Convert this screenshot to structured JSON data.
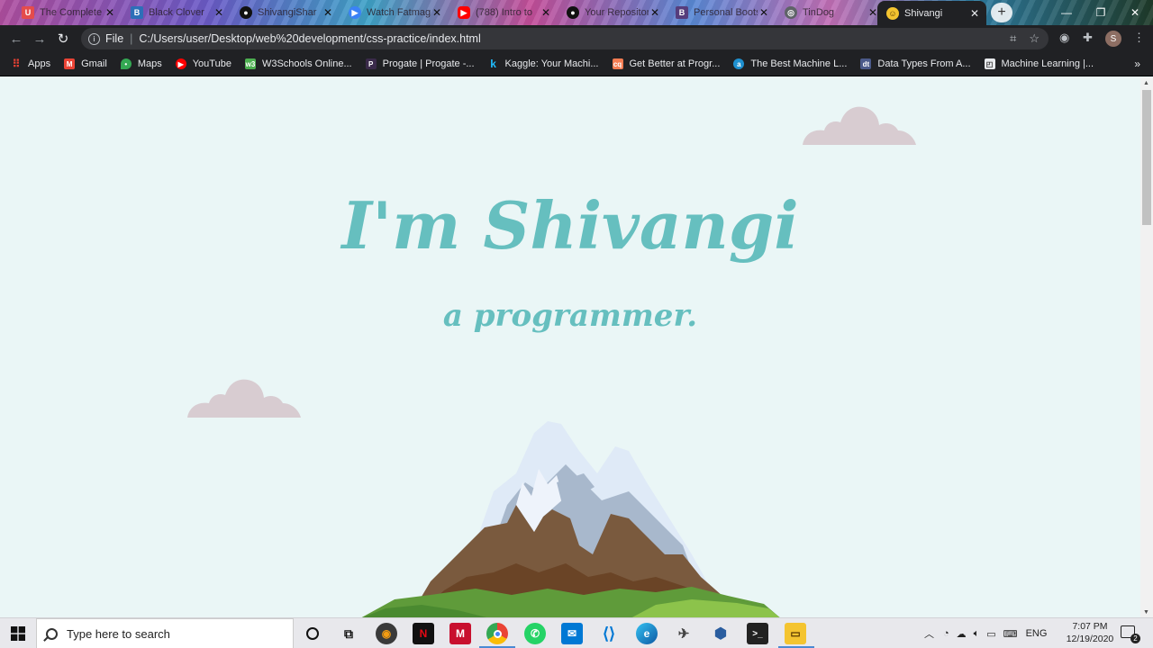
{
  "browser": {
    "tabs": [
      {
        "title": "The Complete",
        "favicon": "udemy-icon",
        "color": "#e44c4c"
      },
      {
        "title": "Black Clover",
        "favicon": "crunchyroll-icon",
        "color": "#2d6fb8"
      },
      {
        "title": "ShivangiShar",
        "favicon": "github-icon",
        "color": "#111111"
      },
      {
        "title": "Watch Fatmagul",
        "favicon": "play-icon",
        "color": "#3b82f6"
      },
      {
        "title": "(788) Intro to",
        "favicon": "youtube-icon",
        "color": "#ff0000"
      },
      {
        "title": "Your Repositor",
        "favicon": "github-icon",
        "color": "#111111"
      },
      {
        "title": "Personal Boots",
        "favicon": "bootstrap-icon",
        "color": "#563d7c"
      },
      {
        "title": "TinDog",
        "favicon": "globe-icon",
        "color": "#5f6368"
      },
      {
        "title": "Shivangi",
        "favicon": "emoji-icon",
        "color": "#f4c430",
        "active": true
      }
    ],
    "address": {
      "scheme_label": "File",
      "url": "C:/Users/user/Desktop/web%20development/css-practice/index.html"
    },
    "profile_initial": "S",
    "bookmarks": [
      {
        "label": "Apps",
        "icon": "apps-grid-icon",
        "color": "#e94235"
      },
      {
        "label": "Gmail",
        "icon": "gmail-icon",
        "color": "#ea4335"
      },
      {
        "label": "Maps",
        "icon": "maps-icon",
        "color": "#34a853"
      },
      {
        "label": "YouTube",
        "icon": "youtube-icon",
        "color": "#ff0000"
      },
      {
        "label": "W3Schools Online...",
        "icon": "w3schools-icon",
        "color": "#4caf50"
      },
      {
        "label": "Progate | Progate -...",
        "icon": "progate-icon",
        "color": "#3a2a4a"
      },
      {
        "label": "Kaggle: Your Machi...",
        "icon": "kaggle-icon",
        "color": "#20beff"
      },
      {
        "label": "Get Better at Progr...",
        "icon": "codequotient-icon",
        "color": "#f57c52"
      },
      {
        "label": "The Best Machine L...",
        "icon": "bookmark-site-icon",
        "color": "#1e90d0"
      },
      {
        "label": "Data Types From A...",
        "icon": "bookmark-site-icon",
        "color": "#4b5a8a"
      },
      {
        "label": "Machine Learning |...",
        "icon": "bookmark-site-icon",
        "color": "#e8eaed"
      }
    ]
  },
  "page": {
    "headline": "I'm Shivangi",
    "subline": "a programmer.",
    "colors": {
      "background": "#eaf6f6",
      "text": "#66bfbf",
      "cloud": "#d8ccd1"
    }
  },
  "taskbar": {
    "search_placeholder": "Type here to search",
    "language": "ENG",
    "time": "7:07 PM",
    "date": "12/19/2020",
    "notifications": "2"
  }
}
